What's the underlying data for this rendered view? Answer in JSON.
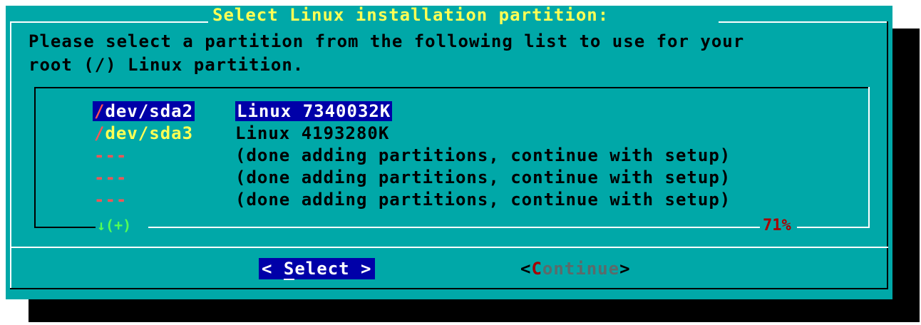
{
  "dialog": {
    "title": "Select Linux installation partition:",
    "prompt_line1": "Please select a partition from the following list to use for your",
    "prompt_line2": "root (/) Linux partition."
  },
  "list": {
    "rows": [
      {
        "first": "/",
        "rest": "dev/sda2",
        "desc": "Linux 7340032K",
        "selected": true
      },
      {
        "first": "/",
        "rest": "dev/sda3",
        "desc": "Linux 4193280K",
        "selected": false
      },
      {
        "tag": "---",
        "desc": "(done adding partitions, continue with setup)",
        "selected": false
      },
      {
        "tag": "---",
        "desc": "(done adding partitions, continue with setup)",
        "selected": false
      },
      {
        "tag": "---",
        "desc": "(done adding partitions, continue with setup)",
        "selected": false
      }
    ],
    "scroll_indicator": "↓(+)",
    "scroll_percent": "71%"
  },
  "buttons": {
    "select": {
      "pre": "< ",
      "hotkey": "S",
      "post": "elect >"
    },
    "continue": {
      "lt": "<",
      "hotkey": "C",
      "post": "ontinue",
      "gt": ">"
    }
  },
  "colors": {
    "dialog_bg": "#00a8a8",
    "shadow": "#000000",
    "title": "#ffff54",
    "selection_bg": "#0000a8",
    "hotkey_red": "#ff5454",
    "percent_red": "#a80000",
    "scroll_green": "#54ff54"
  }
}
